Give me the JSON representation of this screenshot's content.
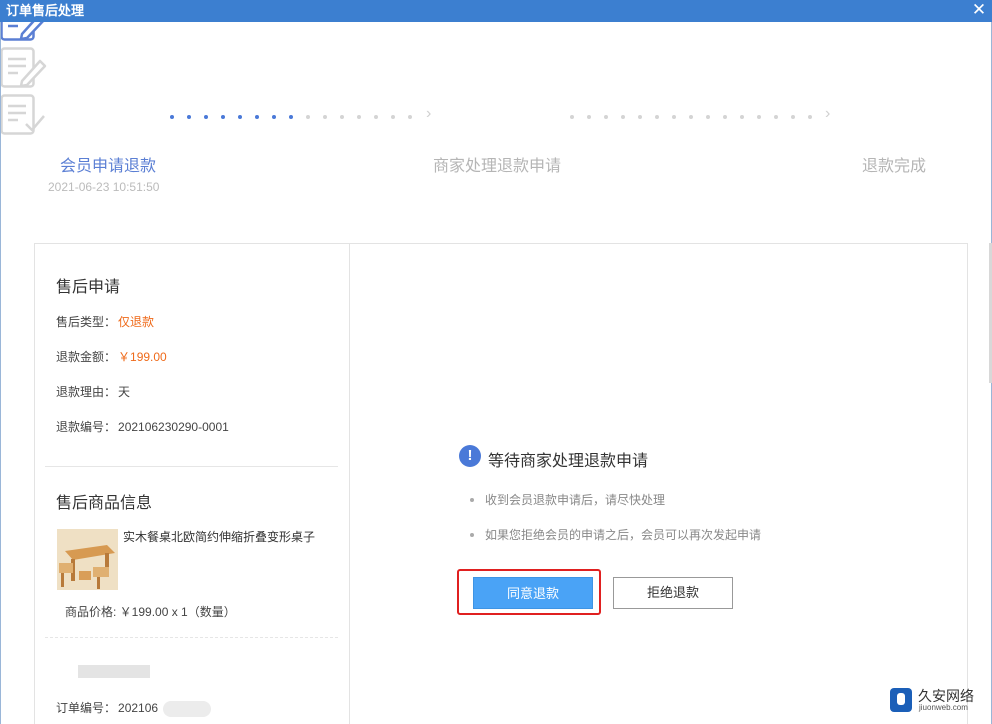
{
  "window": {
    "title": "订单售后处理",
    "close_glyph": "✕"
  },
  "steps": [
    {
      "label": "会员申请退款",
      "time": "2021-06-23 10:51:50",
      "icon": "document-edit-icon",
      "state": "active"
    },
    {
      "label": "商家处理退款申请",
      "icon": "document-edit-icon",
      "state": "pending"
    },
    {
      "label": "退款完成",
      "icon": "document-check-icon",
      "state": "pending"
    }
  ],
  "step_connector_glyph": "›",
  "colors": {
    "accent": "#4a79d8",
    "active_step": "#5b7fd4",
    "inactive_step": "#bbbbbb",
    "orange": "#ef6a1a",
    "agree_button": "#4aa3f6",
    "titlebar": "#3c7fd0",
    "highlight": "#e02020"
  },
  "after_sale": {
    "heading": "售后申请",
    "type_label": "售后类型：",
    "type_value": "仅退款",
    "amount_label": "退款金额：",
    "amount_value": "￥199.00",
    "reason_label": "退款理由：",
    "reason_value": "天",
    "number_label": "退款编号：",
    "number_value": "202106230290-0001"
  },
  "product": {
    "heading": "售后商品信息",
    "name": "实木餐桌北欧简约伸缩折叠变形桌子",
    "price_line": "商品价格: ￥199.00 x 1（数量）"
  },
  "order": {
    "number_label": "订单编号：",
    "number_value": "202106"
  },
  "notice": {
    "icon_glyph": "!",
    "title": "等待商家处理退款申请",
    "bullets": [
      "收到会员退款申请后，请尽快处理",
      "如果您拒绝会员的申请之后，会员可以再次发起申请"
    ]
  },
  "actions": {
    "agree_label": "同意退款",
    "reject_label": "拒绝退款"
  },
  "watermark": {
    "text": "久安网络",
    "sub": "jiuonweb.com"
  }
}
